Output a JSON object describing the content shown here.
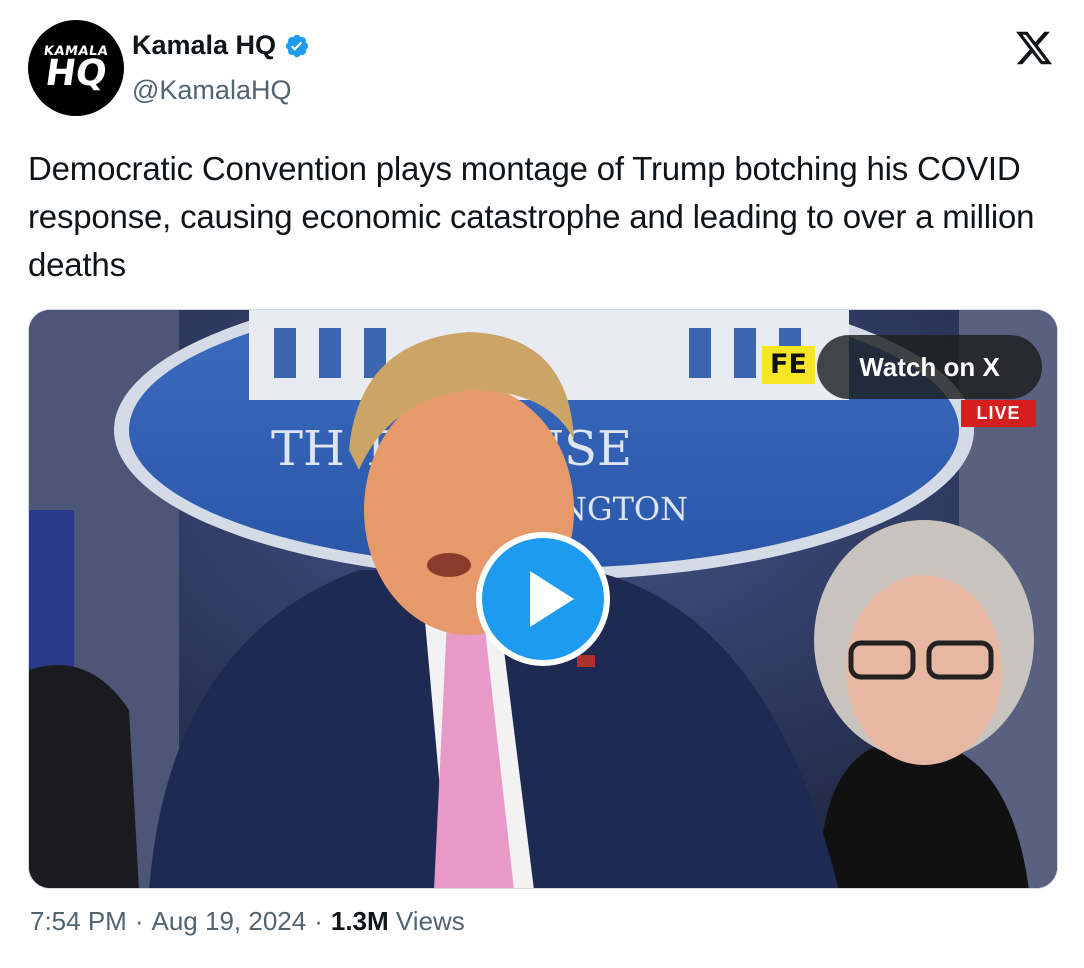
{
  "author": {
    "display_name": "Kamala HQ",
    "handle": "@KamalaHQ",
    "avatar_text_top": "KAMALA",
    "avatar_text_bottom": "HQ",
    "verified_icon": "verified-badge-icon",
    "verified_color": "#1d9bf0"
  },
  "platform_icon": "x-logo-icon",
  "tweet": {
    "text": "Democratic Convention plays montage of Trump botching his COVID response, causing economic catastrophe and leading to over a million deaths"
  },
  "media": {
    "watch_label": "Watch on X",
    "fe_tag": "FE",
    "live_tag": "LIVE",
    "seal_text_1": "TH      TE HOUSE",
    "seal_text_2": "NGTON",
    "play_icon": "play-icon",
    "play_color": "#1d9bf0"
  },
  "meta": {
    "time": "7:54 PM",
    "sep1": "·",
    "date": "Aug 19, 2024",
    "sep2": "·",
    "views_count": "1.3M",
    "views_label": "Views"
  }
}
